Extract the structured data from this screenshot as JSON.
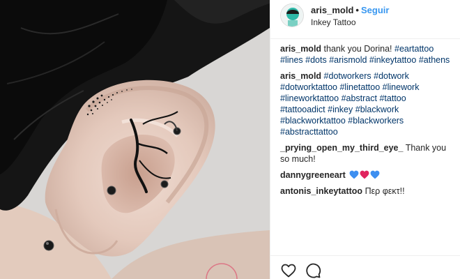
{
  "post": {
    "username": "aris_mold",
    "separator": "•",
    "follow_label": "Seguir",
    "location": "Inkey Tattoo"
  },
  "comments": [
    {
      "user": "aris_mold",
      "text": "thank you Dorina!",
      "hashtags": [
        "#eartattoo",
        "#lines",
        "#dots",
        "#arismold",
        "#inkeytattoo",
        "#athens"
      ]
    },
    {
      "user": "aris_mold",
      "text": "",
      "hashtags": [
        "#dotworkers",
        "#dotwork",
        "#dotworktattoo",
        "#linetattoo",
        "#linework",
        "#lineworktattoo",
        "#abstract",
        "#tattoo",
        "#tattooadict",
        "#inkey",
        "#blackwork",
        "#blackworktattoo",
        "#blackworkers",
        "#abstracttattoo"
      ]
    },
    {
      "user": "_prying_open_my_third_eye_",
      "text": "Thank you so much!",
      "hashtags": []
    },
    {
      "user": "dannygreeneart",
      "text": "",
      "hearts": [
        "#3d8ff0",
        "#e0245e",
        "#3d8ff0"
      ],
      "hashtags": []
    },
    {
      "user": "antonis_inkeytattoo",
      "text": "Περ φεκτ!!",
      "hashtags": []
    }
  ],
  "actions": {
    "like_icon": "heart-outline-icon",
    "comment_icon": "speech-bubble-icon"
  },
  "colors": {
    "link_blue": "#3897f0",
    "hashtag": "#003569",
    "text": "#262626",
    "border": "#efefef"
  }
}
